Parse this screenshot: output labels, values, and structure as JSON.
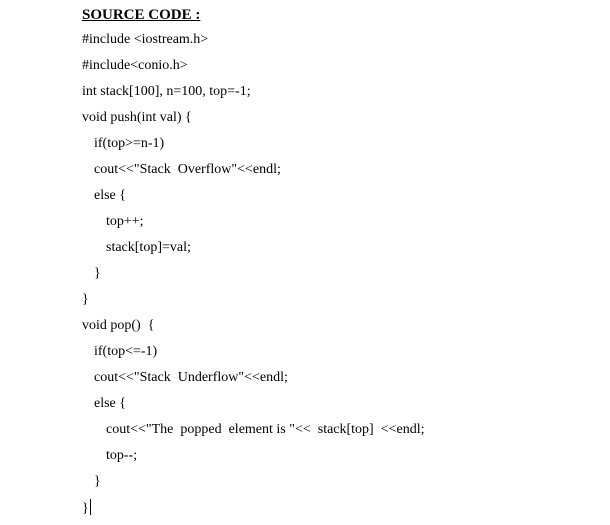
{
  "document": {
    "heading": "SOURCE CODE :",
    "lines": [
      "#include <iostream.h>",
      "#include<conio.h>",
      "int stack[100], n=100, top=-1;",
      "void push(int val) {",
      "if(top>=n-1)",
      "cout<<\"Stack  Overflow\"<<endl;",
      "else {",
      "top++;",
      "stack[top]=val;",
      "}",
      "}",
      "void pop()  {",
      "if(top<=-1)",
      "cout<<\"Stack  Underflow\"<<endl;",
      "else {",
      "cout<<\"The  popped  element is \"<<  stack[top]  <<endl;",
      "top--;",
      "}",
      "}"
    ]
  }
}
